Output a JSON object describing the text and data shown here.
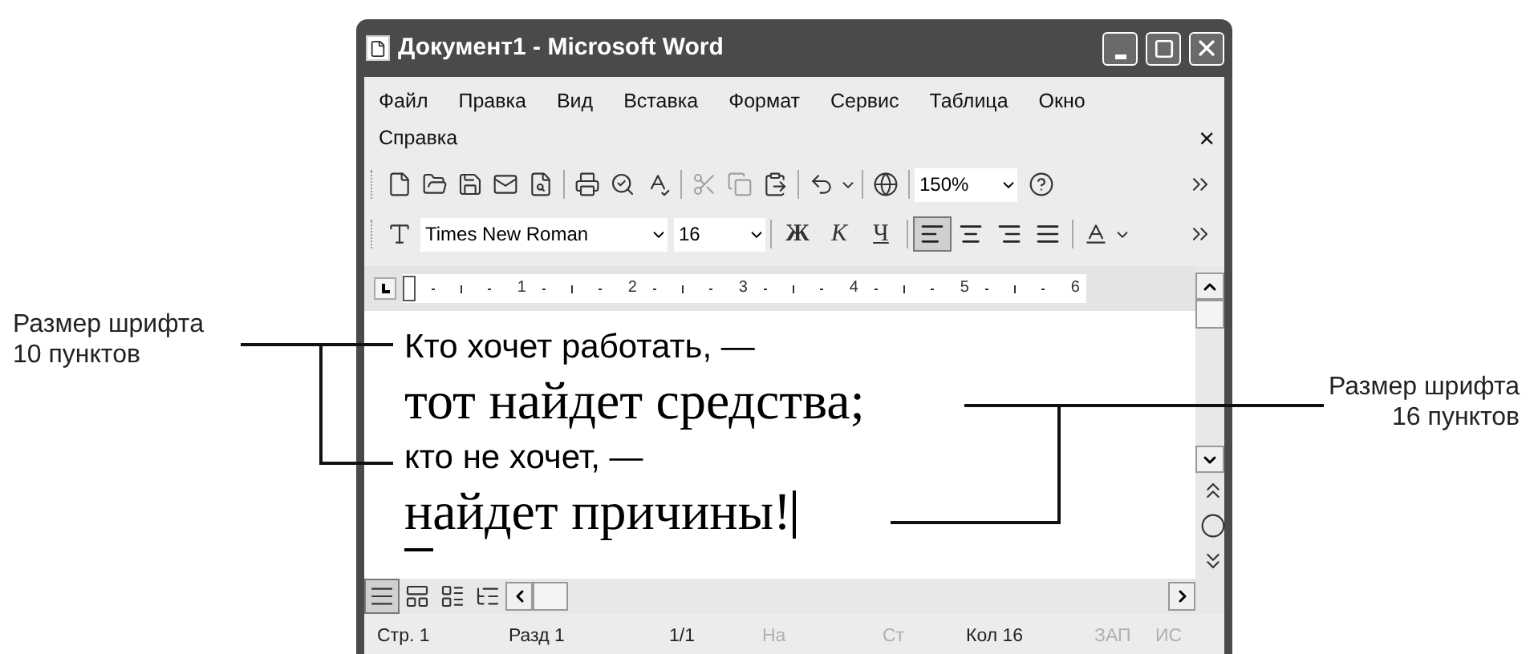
{
  "window": {
    "title": "Документ1 - Microsoft Word"
  },
  "menu": {
    "items": [
      "Файл",
      "Правка",
      "Вид",
      "Вставка",
      "Формат",
      "Сервис",
      "Таблица",
      "Окно",
      "Справка"
    ],
    "close": "×"
  },
  "standard_toolbar": {
    "zoom": "150%"
  },
  "formatting_toolbar": {
    "font": "Times New Roman",
    "size": "16",
    "styles": [
      "Ж",
      "К",
      "Ч"
    ],
    "alignment": [
      {
        "kind": "left",
        "selected": true
      },
      {
        "kind": "center",
        "selected": false
      },
      {
        "kind": "right",
        "selected": false
      },
      {
        "kind": "justify",
        "selected": false
      }
    ]
  },
  "ruler": {
    "numbers": [
      "1",
      "2",
      "3",
      "4",
      "5",
      "6"
    ]
  },
  "document": {
    "lines": [
      {
        "text": "Кто хочет работать, —",
        "kind": "sans",
        "caret": false
      },
      {
        "text": "тот найдет средства;",
        "kind": "serif",
        "caret": false
      },
      {
        "text": "кто не хочет, —",
        "kind": "sans",
        "caret": false
      },
      {
        "text": "найдет причины!",
        "kind": "serif",
        "caret": true
      }
    ]
  },
  "status_bar": [
    {
      "text": "Стр. 1",
      "disabled": false
    },
    {
      "text": "Разд 1",
      "disabled": false
    },
    {
      "text": "1/1",
      "disabled": false
    },
    {
      "text": "На",
      "disabled": true
    },
    {
      "text": "Ст",
      "disabled": true
    },
    {
      "text": "Кол 16",
      "disabled": false
    },
    {
      "text": "ЗАП",
      "disabled": true
    },
    {
      "text": "ИС",
      "disabled": true
    }
  ],
  "callouts": [
    {
      "text": "Размер шрифта\n10 пунктов"
    },
    {
      "text": "Размер шрифта\n16 пунктов"
    }
  ]
}
